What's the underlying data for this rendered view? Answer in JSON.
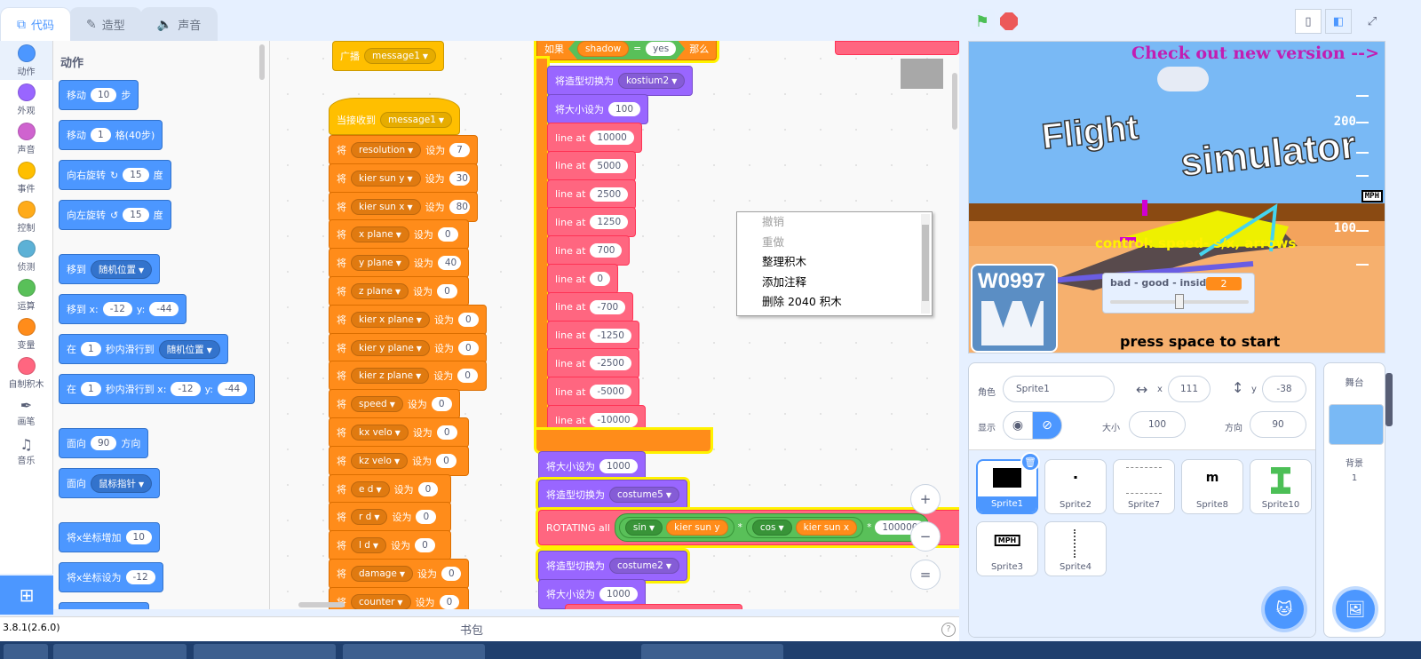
{
  "tabs": [
    {
      "label": "代码",
      "icon": "code-icon"
    },
    {
      "label": "造型",
      "icon": "brush-icon"
    },
    {
      "label": "声音",
      "icon": "speaker-icon"
    }
  ],
  "categories": [
    {
      "label": "动作",
      "color": "#4c97ff"
    },
    {
      "label": "外观",
      "color": "#9966ff"
    },
    {
      "label": "声音",
      "color": "#cf63cf"
    },
    {
      "label": "事件",
      "color": "#ffbf00"
    },
    {
      "label": "控制",
      "color": "#ffab19"
    },
    {
      "label": "侦测",
      "color": "#5cb1d6"
    },
    {
      "label": "运算",
      "color": "#59c059"
    },
    {
      "label": "变量",
      "color": "#ff8c1a"
    },
    {
      "label": "自制积木",
      "color": "#ff6680"
    },
    {
      "label": "画笔",
      "icon": "pen-icon"
    },
    {
      "label": "音乐",
      "icon": "music-icon"
    }
  ],
  "palette": {
    "title": "动作",
    "move": {
      "a": "移动",
      "v": "10",
      "b": "步"
    },
    "step": {
      "a": "移动",
      "v": "1",
      "b": "格(40步)"
    },
    "turn_right": {
      "a": "向右旋转",
      "v": "15",
      "b": "度"
    },
    "turn_left": {
      "a": "向左旋转",
      "v": "15",
      "b": "度"
    },
    "goto": {
      "a": "移到",
      "d": "随机位置"
    },
    "goto_xy": {
      "a": "移到 x:",
      "x": "-12",
      "b": "y:",
      "y": "-44"
    },
    "glide": {
      "a": "在",
      "v": "1",
      "b": "秒内滑行到",
      "d": "随机位置"
    },
    "glide_xy": {
      "a": "在",
      "v": "1",
      "b": "秒内滑行到 x:",
      "x": "-12",
      "c": "y:",
      "y": "-44"
    },
    "point": {
      "a": "面向",
      "v": "90",
      "b": "方向"
    },
    "point_to": {
      "a": "面向",
      "d": "鼠标指针"
    },
    "change_x": {
      "a": "将x坐标增加",
      "v": "10"
    },
    "set_x": {
      "a": "将x坐标设为",
      "v": "-12"
    }
  },
  "script1": {
    "broadcast": "广播",
    "msg": "message1"
  },
  "script2": {
    "hat": "当接收到",
    "msg": "message1",
    "set_word": "将",
    "to_word": "设为",
    "vars": [
      {
        "name": "resolution",
        "value": "7"
      },
      {
        "name": "kier sun y",
        "value": "30"
      },
      {
        "name": "kier sun x",
        "value": "80"
      },
      {
        "name": "x plane",
        "value": "0"
      },
      {
        "name": "y plane",
        "value": "40"
      },
      {
        "name": "z plane",
        "value": "0"
      },
      {
        "name": "kier x plane",
        "value": "0"
      },
      {
        "name": "kier y plane",
        "value": "0"
      },
      {
        "name": "kier z plane",
        "value": "0"
      },
      {
        "name": "speed",
        "value": "0"
      },
      {
        "name": "kx velo",
        "value": "0"
      },
      {
        "name": "kz velo",
        "value": "0"
      },
      {
        "name": "e d",
        "value": "0"
      },
      {
        "name": "r d",
        "value": "0"
      },
      {
        "name": "l d",
        "value": "0"
      },
      {
        "name": "damage",
        "value": "0"
      },
      {
        "name": "counter",
        "value": "0"
      }
    ]
  },
  "script3": {
    "if_word": "如果",
    "shadow": "shadow",
    "eq": "=",
    "yes": "yes",
    "then_word": "那么",
    "switch_costume": "将造型切换为",
    "costume_a": "kostium2",
    "set_size": "将大小设为",
    "size_a": "100",
    "line_label": "line at",
    "lines": [
      "10000",
      "5000",
      "2500",
      "1250",
      "700",
      "0",
      "-700",
      "-1250",
      "-2500",
      "-5000",
      "-10000"
    ],
    "size_b": "1000",
    "costume_b": "costume5",
    "rotating": "ROTATING all",
    "sin": "sin",
    "cos": "cos",
    "ksy": "kier sun y",
    "ksx": "kier sun x",
    "mul": "*",
    "num": "100000",
    "costume_c": "costume2",
    "size_c": "1000"
  },
  "context_menu": [
    "撤销",
    "重做",
    "整理积木",
    "添加注释",
    "删除 2040 积木"
  ],
  "zoom": {
    "in": "+",
    "out": "−",
    "reset": "="
  },
  "bottom": {
    "version": "3.8.1(2.6.0)",
    "backpack": "书包",
    "help": "?"
  },
  "stage": {
    "check": "Check out new version -->",
    "title1": "Flight",
    "title2": "simulator",
    "control": "control: speed- s/x, arrows",
    "logo": "W0997",
    "ticks": [
      "100",
      "200",
      "100"
    ],
    "mph": "MPH",
    "monitor_label": "bad - good - inside",
    "monitor_value": "2",
    "monitor_level": 0.5,
    "press": "press space to start"
  },
  "sprite_info": {
    "sprite_label": "角色",
    "sprite_name": "Sprite1",
    "x_label": "x",
    "x": "111",
    "y_label": "y",
    "y": "-38",
    "show_label": "显示",
    "size_label": "大小",
    "size": "100",
    "dir_label": "方向",
    "dir": "90"
  },
  "sprites": [
    "Sprite1",
    "Sprite2",
    "Sprite7",
    "Sprite8",
    "Sprite10",
    "Sprite3",
    "Sprite4"
  ],
  "stage_pane": {
    "title": "舞台",
    "backdrop_label": "背景",
    "backdrop_count": "1"
  }
}
